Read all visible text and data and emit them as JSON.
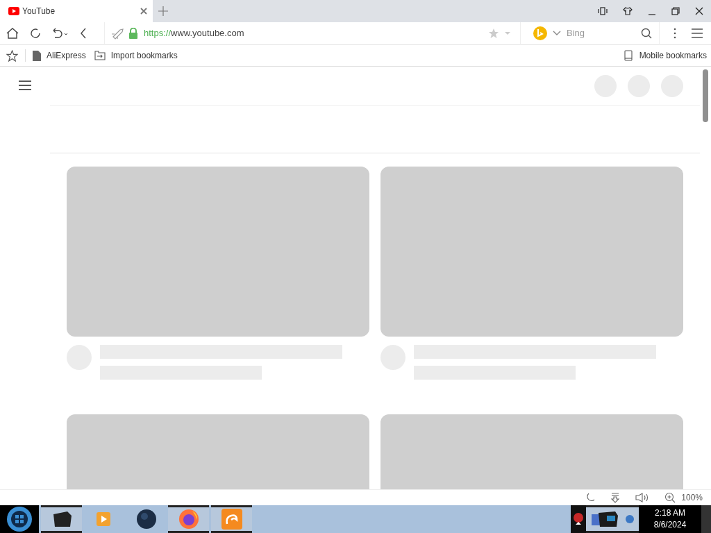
{
  "tabs": [
    {
      "title": "YouTube",
      "selected": true
    }
  ],
  "address_bar": {
    "url": "https://www.youtube.com"
  },
  "search_box": {
    "placeholder": "Bing"
  },
  "bookmarks": [
    {
      "kind": "page",
      "label": "AliExpress"
    },
    {
      "kind": "import",
      "label": "Import bookmarks"
    }
  ],
  "mobile_bookmarks": "Mobile bookmarks",
  "status_bar": {
    "zoom": "100%"
  },
  "taskbar": {
    "time": "2:18 AM",
    "date": "8/6/2024"
  }
}
